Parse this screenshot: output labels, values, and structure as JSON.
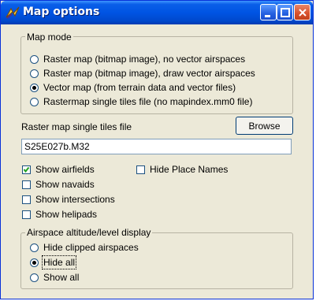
{
  "window": {
    "title": "Map options"
  },
  "map_mode": {
    "legend": "Map mode",
    "options": [
      {
        "label": "Raster map (bitmap image), no vector airspaces",
        "selected": false
      },
      {
        "label": "Raster map (bitmap image), draw vector airspaces",
        "selected": false
      },
      {
        "label": "Vector map (from terrain data and vector files)",
        "selected": true
      },
      {
        "label": "Rastermap single tiles file (no mapindex.mm0 file)",
        "selected": false
      }
    ]
  },
  "tiles_file": {
    "label": "Raster map single tiles file",
    "browse_label": "Browse",
    "value": "S25E027b.M32"
  },
  "checkboxes": [
    {
      "label": "Show airfields",
      "checked": true
    },
    {
      "label": "Hide Place Names",
      "checked": false
    },
    {
      "label": "Show navaids",
      "checked": false
    },
    {
      "label": "Show intersections",
      "checked": false
    },
    {
      "label": "Show helipads",
      "checked": false
    }
  ],
  "altitude_display": {
    "legend": "Airspace altitude/level display",
    "options": [
      {
        "label": "Hide clipped airspaces",
        "selected": false
      },
      {
        "label": "Hide all",
        "selected": true
      },
      {
        "label": "Show all",
        "selected": false
      }
    ]
  },
  "colors": {
    "titlebar": "#0054e3",
    "face": "#ece9d8",
    "close": "#d8502a"
  }
}
